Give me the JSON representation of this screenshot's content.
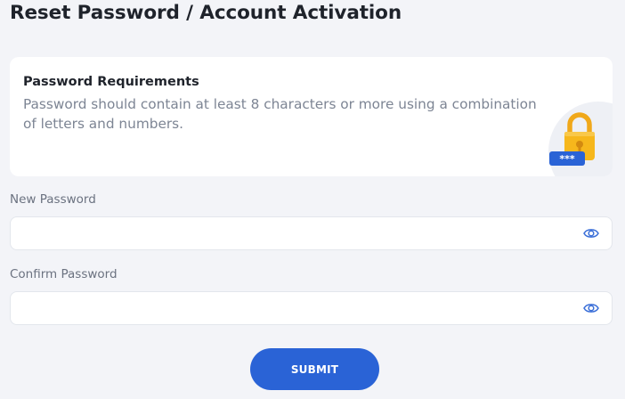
{
  "page": {
    "title": "Reset Password / Account Activation"
  },
  "requirements": {
    "heading": "Password Requirements",
    "text": "Password should contain at least 8 characters or more using a combination of letters and numbers.",
    "badge_text": "***",
    "icon": "padlock-icon"
  },
  "fields": {
    "new_password": {
      "label": "New Password",
      "value": "",
      "placeholder": "",
      "toggle_icon": "eye-icon"
    },
    "confirm_password": {
      "label": "Confirm Password",
      "value": "",
      "placeholder": "",
      "toggle_icon": "eye-icon"
    }
  },
  "actions": {
    "submit_label": "SUBMIT"
  },
  "colors": {
    "background": "#f3f4f8",
    "card": "#ffffff",
    "accent": "#2a63d6",
    "lock_yellow": "#f6b71c",
    "title_text": "#1f232b",
    "muted_text": "#7d8594"
  }
}
